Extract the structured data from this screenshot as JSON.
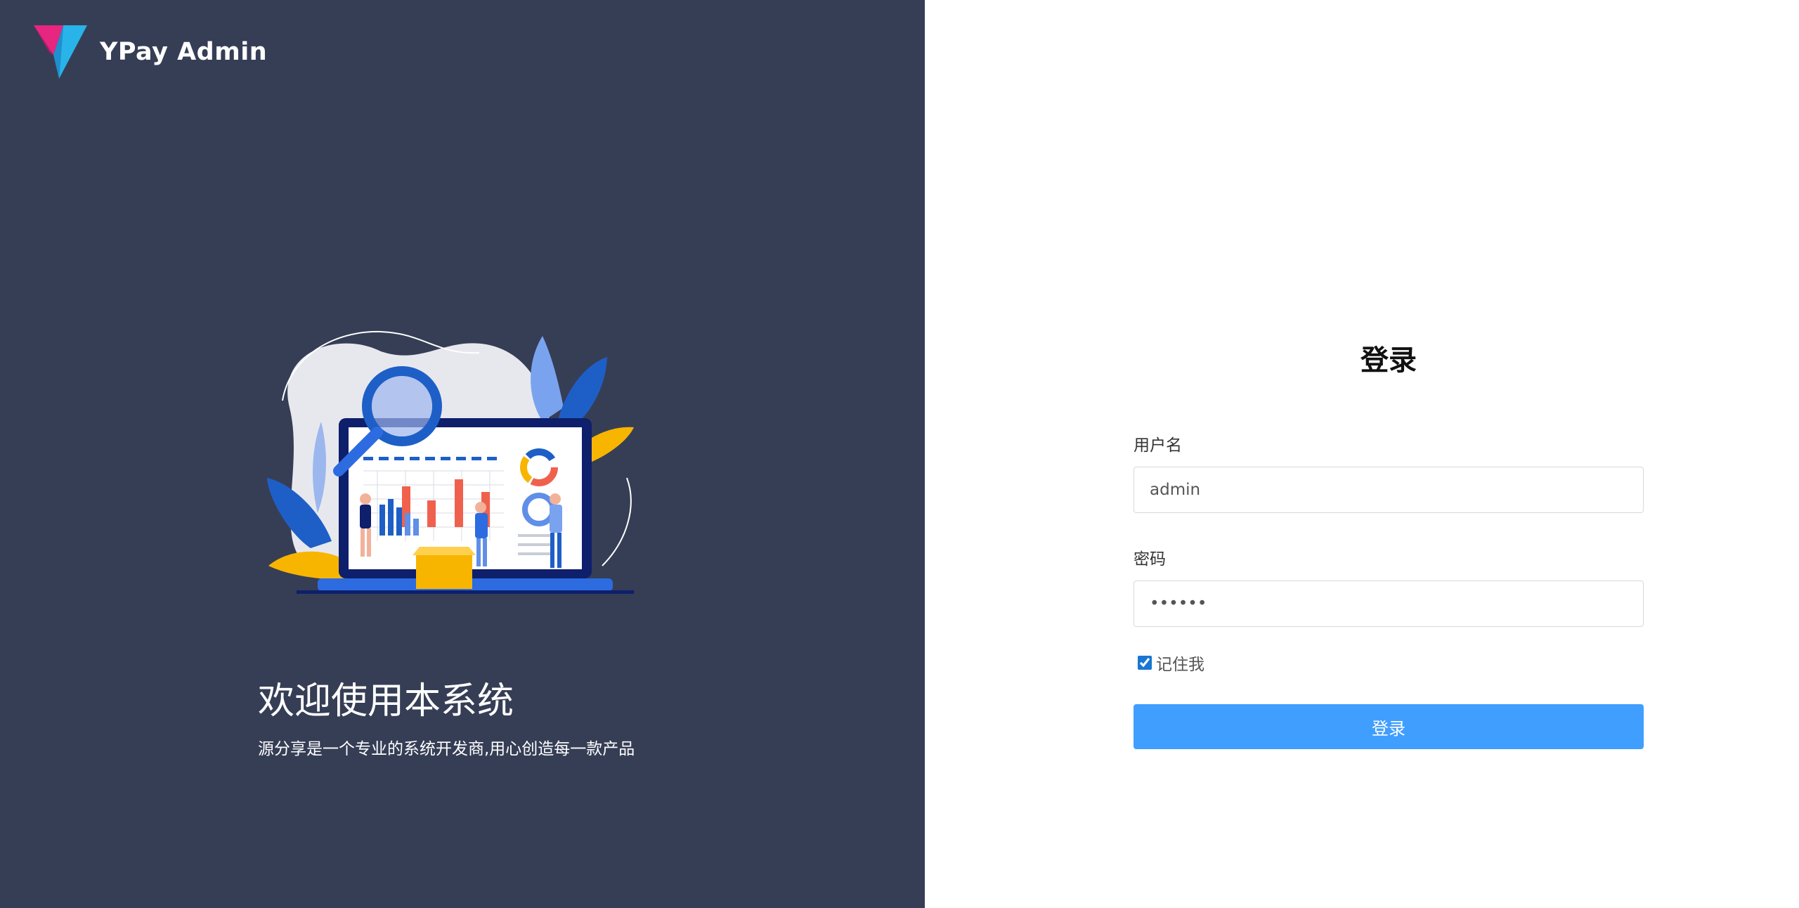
{
  "brand": {
    "name": "YPay Admin",
    "logo_icon": "ypay-logo-icon"
  },
  "welcome": {
    "title": "欢迎使用本系统",
    "subtitle": "源分享是一个专业的系统开发商,用心创造每一款产品"
  },
  "illustration": {
    "icon": "analytics-dashboard-illustration"
  },
  "login_form": {
    "title": "登录",
    "username_label": "用户名",
    "username_value": "admin",
    "password_label": "密码",
    "password_value": "••••••",
    "remember_label": "记住我",
    "remember_checked": true,
    "submit_label": "登录"
  },
  "colors": {
    "left_panel_bg": "#363e56",
    "primary_button": "#409eff",
    "logo_pink": "#e6267f",
    "logo_cyan": "#28b4e8"
  }
}
